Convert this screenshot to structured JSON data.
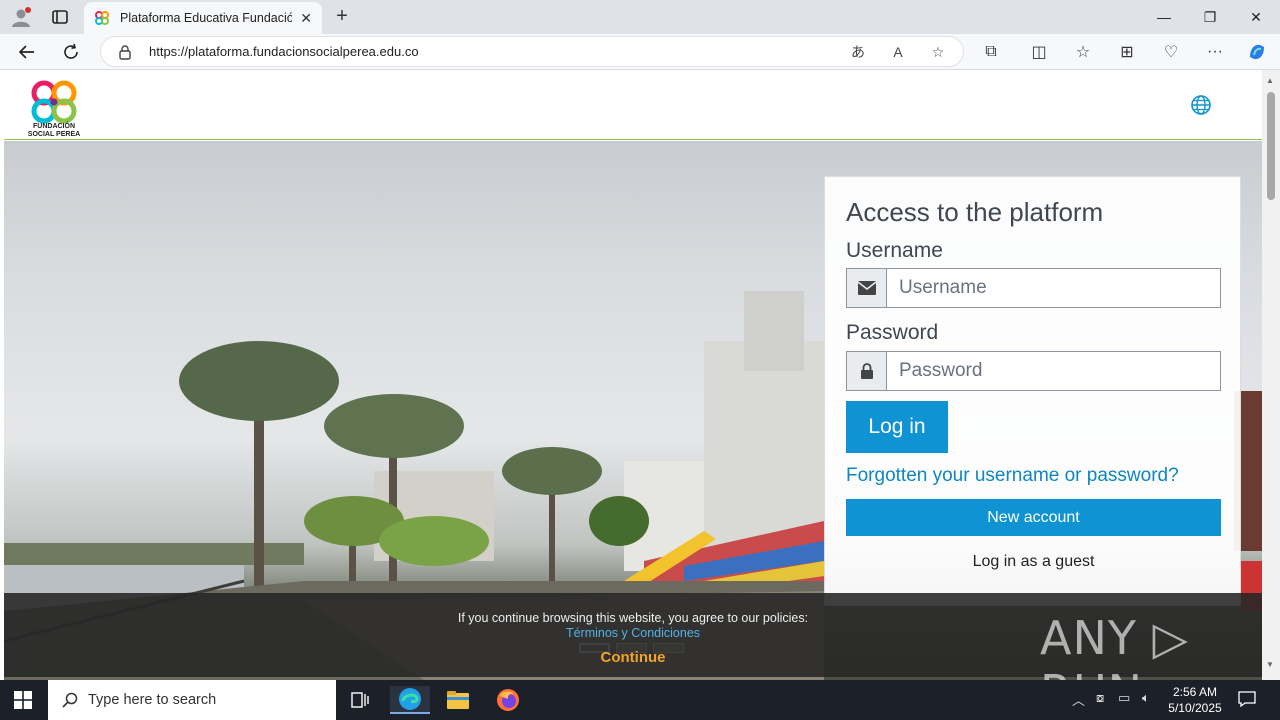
{
  "browser": {
    "tab_title": "Plataforma Educativa Fundación",
    "tab_close": "✕",
    "new_tab": "+",
    "url": "https://plataforma.fundacionsocialperea.edu.co",
    "window_minimize": "—",
    "window_restore": "❐",
    "window_close": "✕",
    "more_menu": "···"
  },
  "header": {
    "logo_text_line1": "FUNDACIÓN",
    "logo_text_line2": "SOCIAL PEREA"
  },
  "login": {
    "title": "Access to the platform",
    "username_label": "Username",
    "username_placeholder": "Username",
    "password_label": "Password",
    "password_placeholder": "Password",
    "login_button": "Log in",
    "forgot_link": "Forgotten your username or password?",
    "new_account_button": "New account",
    "guest_link": "Log in as a guest"
  },
  "cookie": {
    "message": "If you continue browsing this website, you agree to our policies:",
    "policy_link": "Términos y Condiciones",
    "continue": "Continue"
  },
  "watermark": "ANY ▷ RUN",
  "taskbar": {
    "search_placeholder": "Type here to search",
    "time": "2:56 AM",
    "date": "5/10/2025"
  },
  "colors": {
    "primary": "#0f93d3",
    "link": "#0f86c3",
    "continue": "#f0a526",
    "header_border": "#8fc25a"
  }
}
